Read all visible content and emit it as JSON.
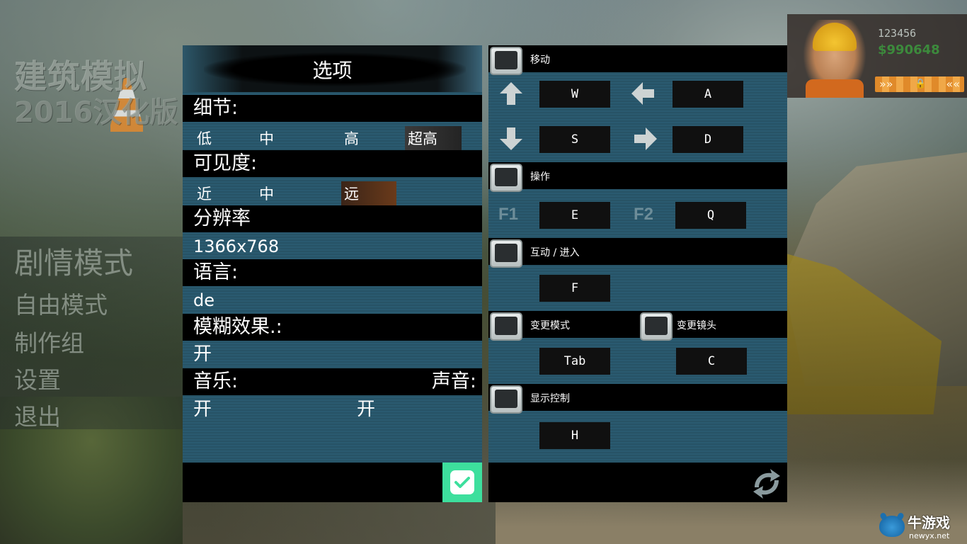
{
  "logo": {
    "line1": "建筑模拟",
    "line2": "2016汉化版"
  },
  "main_menu": {
    "items": [
      {
        "label": "剧情模式"
      },
      {
        "label": "自由模式"
      },
      {
        "label": "制作组"
      },
      {
        "label": "设置"
      },
      {
        "label": "退出"
      }
    ]
  },
  "profile": {
    "name": "123456",
    "money": "$990648"
  },
  "options": {
    "title": "选项",
    "detail": {
      "label": "细节:",
      "choices": [
        "低",
        "中",
        "高",
        "超高"
      ],
      "selected": "超高"
    },
    "visibility": {
      "label": "可见度:",
      "choices": [
        "近",
        "中",
        "远"
      ],
      "selected": "远"
    },
    "resolution": {
      "label": "分辨率",
      "value": "1366x768"
    },
    "language": {
      "label": "语言:",
      "value": "de"
    },
    "blur": {
      "label": "模糊效果.:",
      "value": "开"
    },
    "music": {
      "label": "音乐:",
      "value": "开"
    },
    "sound": {
      "label": "声音:",
      "value": "开"
    }
  },
  "controls": {
    "move": {
      "label": "移动",
      "up": "W",
      "left": "A",
      "down": "S",
      "right": "D"
    },
    "operate": {
      "label": "操作",
      "f1_label": "F1",
      "f1_key": "E",
      "f2_label": "F2",
      "f2_key": "Q"
    },
    "interact": {
      "label": "互动 / 进入",
      "key": "F"
    },
    "change_mode": {
      "label": "变更模式",
      "key": "Tab"
    },
    "change_camera": {
      "label": "变更镜头",
      "key": "C"
    },
    "show_controls": {
      "label": "显示控制",
      "key": "H"
    }
  },
  "watermark": {
    "title": "牛游戏",
    "url": "newyx.net"
  },
  "colors": {
    "confirm": "#3ddf9d",
    "stripe_blue": "#2a5a70",
    "money": "#3c8a3c",
    "level_bar": "#e08a2a"
  },
  "icons": [
    "confirm-check-icon",
    "reset-arrows-icon",
    "arrow-up-icon",
    "arrow-down-icon",
    "arrow-left-icon",
    "arrow-right-icon",
    "lock-icon"
  ]
}
